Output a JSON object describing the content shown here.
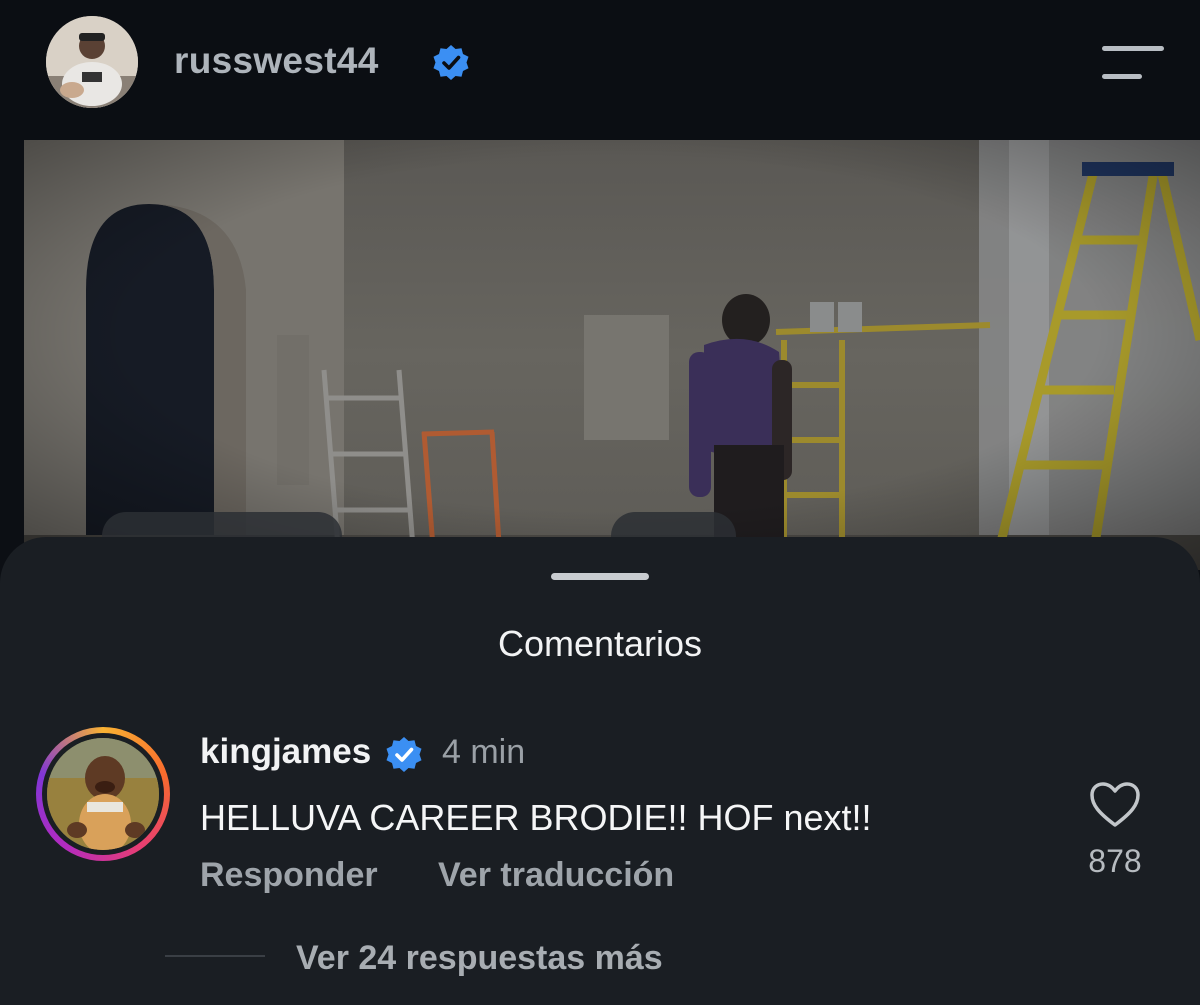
{
  "header": {
    "username": "russwest44",
    "verified": true,
    "menu_icon": "hamburger-menu-icon"
  },
  "sheet": {
    "title": "Comentarios"
  },
  "comment": {
    "username": "kingjames",
    "verified": true,
    "time": "4 min",
    "text": "HELLUVA CAREER BRODIE!! HOF next!!",
    "reply_label": "Responder",
    "translate_label": "Ver traducción",
    "likes": "878",
    "like_icon": "heart-icon",
    "replies_label": "Ver 24 respuestas más"
  },
  "colors": {
    "verified_badge": "#3b8ff3",
    "background": "#0c0f14",
    "sheet": "#1a1e23"
  }
}
